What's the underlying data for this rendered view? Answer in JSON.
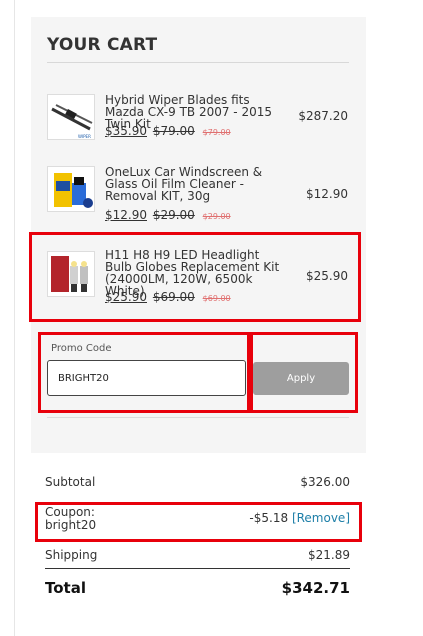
{
  "cart": {
    "title": "YOUR CART",
    "items": [
      {
        "name": "Hybrid Wiper Blades fits Mazda CX-9 TB 2007 - 2015 Twin Kit",
        "price": "$35.90",
        "was": "$79.00",
        "was_small": "$79.00",
        "total": "$287.20",
        "thumb_icon": "wiper-blade-image"
      },
      {
        "name": "OneLux Car Windscreen & Glass Oil Film Cleaner - Removal KIT, 30g",
        "price": "$12.90",
        "was": "$29.00",
        "was_small": "$29.00",
        "total": "$12.90",
        "thumb_icon": "cleaner-kit-image"
      },
      {
        "name": "H11 H8 H9 LED Headlight Bulb Globes Replacement Kit (24000LM, 120W, 6500k White)",
        "price": "$25.90",
        "was": "$69.00",
        "was_small": "$69.00",
        "total": "$25.90",
        "thumb_icon": "headlight-bulb-image"
      }
    ]
  },
  "promo": {
    "label": "Promo Code",
    "value": "BRIGHT20",
    "apply_label": "Apply"
  },
  "summary": {
    "subtotal_label": "Subtotal",
    "subtotal_value": "$326.00",
    "coupon_label_1": "Coupon:",
    "coupon_label_2": "bright20",
    "coupon_value": "-$5.18",
    "remove_label": "[Remove]",
    "shipping_label": "Shipping",
    "shipping_value": "$21.89",
    "total_label": "Total",
    "total_value": "$342.71"
  },
  "colors": {
    "highlight": "#e8000b",
    "link": "#1e7fa8",
    "apply_button": "#9e9e9e",
    "panel": "#f5f5f5"
  }
}
